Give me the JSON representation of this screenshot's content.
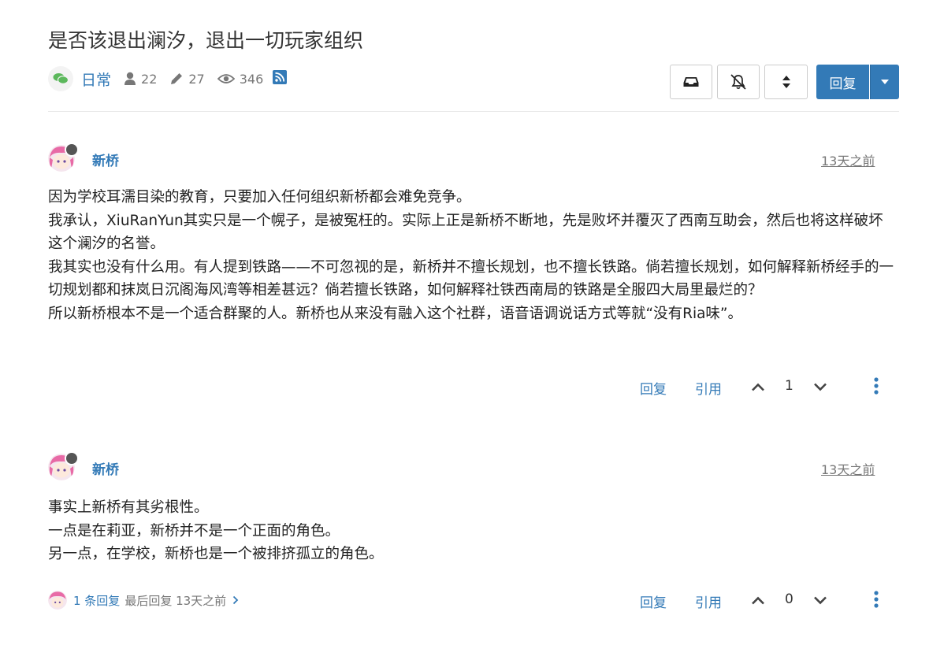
{
  "topic": {
    "title": "是否该退出澜汐，退出一切玩家组织",
    "category": "日常",
    "posters": "22",
    "posts": "27",
    "views": "346"
  },
  "toolbar": {
    "reply_label": "回复"
  },
  "posts": [
    {
      "username": "新桥",
      "timestamp": "13天之前",
      "paragraphs": [
        "因为学校耳濡目染的教育，只要加入任何组织新桥都会难免竞争。",
        "我承认，XiuRanYun其实只是一个幌子，是被冤枉的。实际上正是新桥不断地，先是败坏并覆灭了西南互助会，然后也将这样破坏这个澜汐的名誉。",
        "我其实也没有什么用。有人提到铁路——不可忽视的是，新桥并不擅长规划，也不擅长铁路。倘若擅长规划，如何解释新桥经手的一切规划都和抹岚日沉阁海风湾等相差甚远？倘若擅长铁路，如何解释社铁西南局的铁路是全服四大局里最烂的？",
        "所以新桥根本不是一个适合群聚的人。新桥也从来没有融入这个社群，语音语调说话方式等就“没有Ria味”。"
      ],
      "reply_label": "回复",
      "quote_label": "引用",
      "votes": "1"
    },
    {
      "username": "新桥",
      "timestamp": "13天之前",
      "paragraphs": [
        "事实上新桥有其劣根性。",
        "一点是在莉亚，新桥并不是一个正面的角色。",
        "另一点，在学校，新桥也是一个被排挤孤立的角色。"
      ],
      "reply_label": "回复",
      "quote_label": "引用",
      "votes": "0",
      "replies_link": "1 条回复",
      "last_reply": "最后回复 13天之前"
    }
  ],
  "colors": {
    "accent": "#337ab7",
    "avatar_pink": "#e86aa6"
  },
  "icons": {
    "category": "comments-icon",
    "posters": "user-icon",
    "posts": "pencil-icon",
    "views": "eye-icon",
    "rss": "rss-icon"
  }
}
